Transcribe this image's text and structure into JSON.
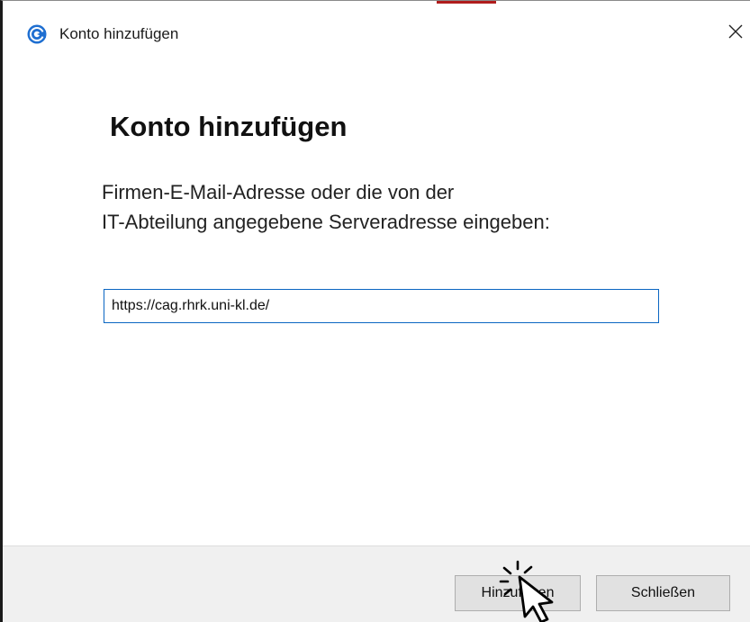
{
  "window": {
    "title": "Konto hinzufügen",
    "close_glyph": "×",
    "icon": "app-logo-icon"
  },
  "main": {
    "heading": "Konto hinzufügen",
    "instruction_line1": "Firmen-E-Mail-Adresse oder die von der",
    "instruction_line2": "IT-Abteilung angegebene Serveradresse eingeben:",
    "server_input": {
      "value": "https://cag.rhrk.uni-kl.de/",
      "placeholder": ""
    }
  },
  "footer": {
    "add_label": "Hinzufügen",
    "close_label": "Schließen"
  },
  "colors": {
    "input_border": "#0a66c2",
    "footer_background": "#f0f0f0",
    "button_background": "#e1e1e1",
    "top_accent": "#b01c1c"
  },
  "overlay": {
    "cursor": "click-pointer-icon"
  }
}
